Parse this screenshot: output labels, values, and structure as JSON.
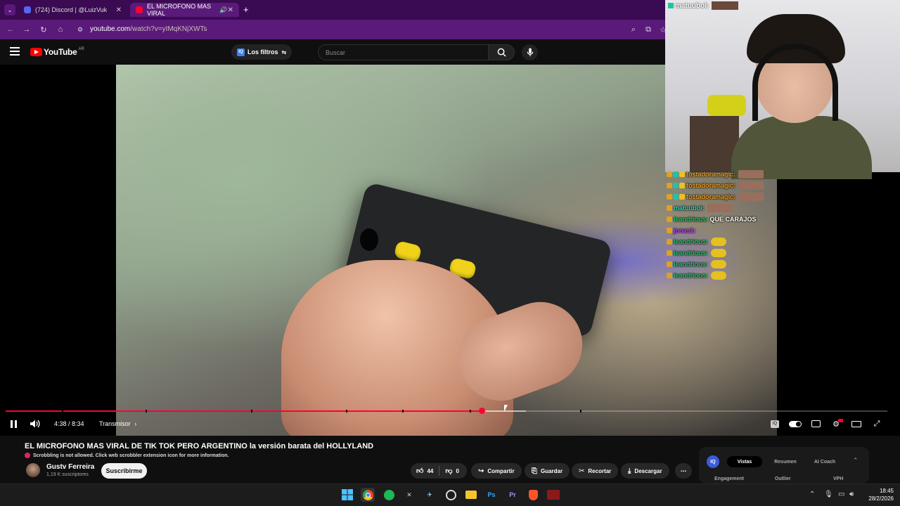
{
  "browser": {
    "tabs": [
      {
        "label": "(724) Discord | @LuizVuk",
        "favicon_color": "#5865f2",
        "active": false
      },
      {
        "label": "EL MICROFONO MAS VIRAL",
        "favicon_color": "#ff0033",
        "active": true
      }
    ],
    "url_host": "youtube.com",
    "url_path": "/watch?v=yIMqKNjXWTs"
  },
  "youtube": {
    "logo_text": "YouTube",
    "region": "AR",
    "filters_label": "Los filtros",
    "search_placeholder": "Buscar"
  },
  "overlay": {
    "cam_user": "matuuboi",
    "chat": [
      {
        "user": "tostadoramagic",
        "color": "#f0a020",
        "msg": "",
        "emote": "large"
      },
      {
        "user": "tostadoramagic",
        "color": "#f0a020",
        "msg": "",
        "emote": "large"
      },
      {
        "user": "tostadoramagic",
        "color": "#f0a020",
        "msg": "",
        "emote": "large"
      },
      {
        "user": "matuuboi",
        "color": "#20e0c0",
        "msg": "",
        "emote": "large"
      },
      {
        "user": "leandrious",
        "color": "#22cc66",
        "msg": "QUE CARAJOS",
        "emote": ""
      },
      {
        "user": "jonas1",
        "color": "#c040ff",
        "msg": "",
        "emote": ""
      },
      {
        "user": "leandrious",
        "color": "#22cc66",
        "msg": "",
        "emote": "small"
      },
      {
        "user": "leandrious",
        "color": "#22cc66",
        "msg": "",
        "emote": "small"
      },
      {
        "user": "leandrious",
        "color": "#22cc66",
        "msg": "",
        "emote": "small"
      },
      {
        "user": "leandrious",
        "color": "#22cc66",
        "msg": "",
        "emote": "small"
      }
    ]
  },
  "player": {
    "time": "4:38 / 8:34",
    "chapter": "Transmisor",
    "progress": 0.54,
    "buffered": 0.59
  },
  "video": {
    "title": "EL MICROFONO MAS VIRAL DE TIK TOK PERO ARGENTINO la versión barata del HOLLYLAND",
    "scrobble_notice": "Scrobbling is not allowed. Click web scrobbler extension icon for more information.",
    "channel_name": "Gustv Ferreira",
    "channel_subs": "1,19 K suscriptores",
    "subscribe_label": "Suscribirme",
    "likes": "44",
    "dislikes": "0",
    "share_label": "Compartir",
    "save_label": "Guardar",
    "clip_label": "Recortar",
    "download_label": "Descargar"
  },
  "vidiq": {
    "badge": "IQ",
    "tabs": [
      "Vistas",
      "Resumen",
      "AI Coach"
    ],
    "metrics": [
      "Engagement",
      "Outlier",
      "VPH"
    ]
  },
  "taskbar": {
    "time": "18:45",
    "date": "28/2/2026"
  }
}
